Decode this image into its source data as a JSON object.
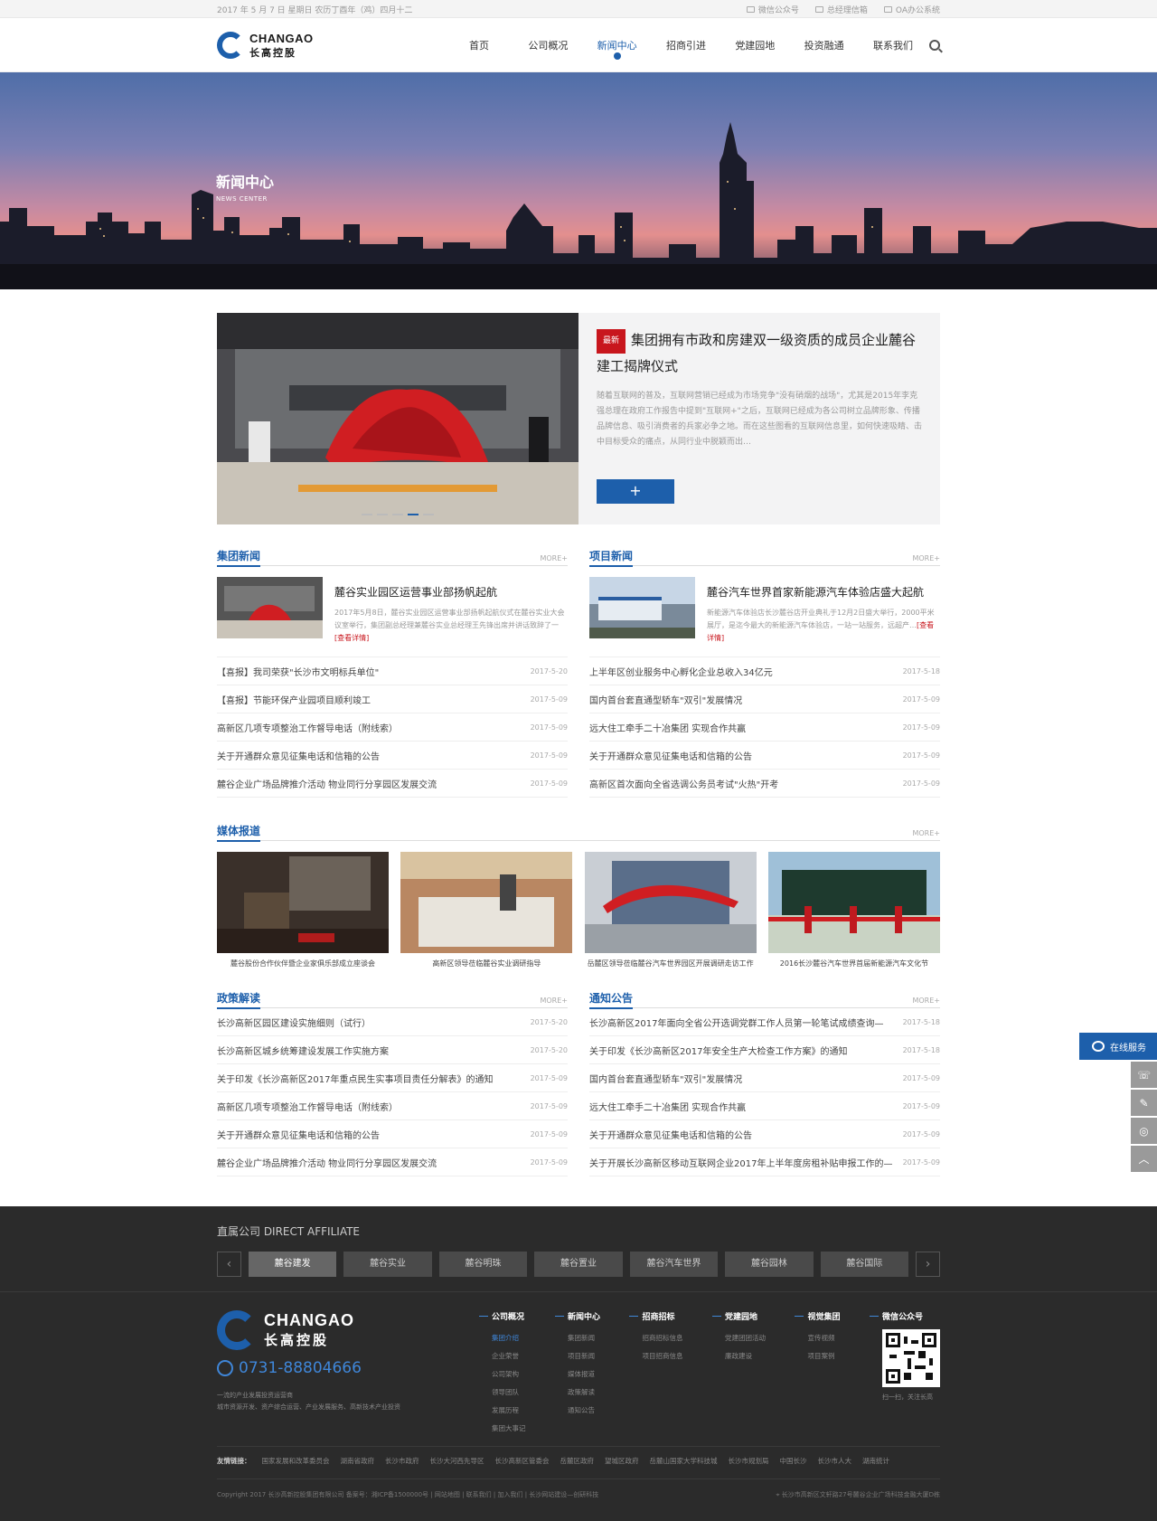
{
  "topbar": {
    "date": "2017 年 5 月 7 日  星期日  农历丁酉年（鸡）四月十二",
    "links": [
      "微信公众号",
      "总经理信箱",
      "OA办公系统"
    ]
  },
  "header": {
    "logo_en": "CHANGAO",
    "logo_cn": "长高控股",
    "nav": [
      "首页",
      "公司概况",
      "新闻中心",
      "招商引进",
      "党建园地",
      "投资融通",
      "联系我们"
    ],
    "active_nav": "新闻中心"
  },
  "banner": {
    "title_cn": "新闻中心",
    "title_en": "NEWS CENTER"
  },
  "feature": {
    "badge": "最新",
    "title": "集团拥有市政和房建双一级资质的成员企业麓谷建工揭牌仪式",
    "desc": "随着互联网的普及，互联网营销已经成为市场竞争\"没有硝烟的战场\"，尤其是2015年李克强总理在政府工作报告中提到\"互联网+\"之后，互联网已经成为各公司树立品牌形象、传播品牌信息、吸引消费者的兵家必争之地。而在这些图看的互联网信息里，如何快速吸睛、击中目标受众的痛点，从同行业中脱颖而出…",
    "button": "+"
  },
  "group_news": {
    "title": "集团新闻",
    "more": "MORE+",
    "top": {
      "headline": "麓谷实业园区运营事业部扬帆起航",
      "desc": "2017年5月8日，麓谷实业园区运营事业部扬帆起航仪式在麓谷实业大会议室举行，集团副总经理兼麓谷实业总经理王先锋出席并讲话致辞了一",
      "more": "[查看详情]"
    },
    "items": [
      {
        "title": "【喜报】我司荣获\"长沙市文明标兵单位\"",
        "date": "2017-5-20"
      },
      {
        "title": "【喜报】节能环保产业园项目顺利竣工",
        "date": "2017-5-09"
      },
      {
        "title": "高新区几项专项整治工作督导电话（附线索）",
        "date": "2017-5-09"
      },
      {
        "title": "关于开通群众意见征集电话和信箱的公告",
        "date": "2017-5-09"
      },
      {
        "title": "麓谷企业广场品牌推介活动  物业同行分享园区发展交流",
        "date": "2017-5-09"
      }
    ]
  },
  "project_news": {
    "title": "项目新闻",
    "more": "MORE+",
    "top": {
      "headline": "麓谷汽车世界首家新能源汽车体验店盛大起航",
      "desc": "新能源汽车体验店长沙麓谷店开业典礼于12月2日盛大举行，2000平米展厅，是迄今最大的新能源汽车体验店，一站一站服务，远超产…",
      "more": "[查看详情]"
    },
    "items": [
      {
        "title": "上半年区创业服务中心孵化企业总收入34亿元",
        "date": "2017-5-18"
      },
      {
        "title": "国内首台套直通型轿车\"双引\"发展情况",
        "date": "2017-5-09"
      },
      {
        "title": "远大住工牵手二十冶集团  实现合作共赢",
        "date": "2017-5-09"
      },
      {
        "title": "关于开通群众意见征集电话和信箱的公告",
        "date": "2017-5-09"
      },
      {
        "title": "高新区首次面向全省选调公务员考试\"火热\"开考",
        "date": "2017-5-09"
      }
    ]
  },
  "media": {
    "title": "媒体报道",
    "more": "MORE+",
    "items": [
      "麓谷股份合作伙伴暨企业家俱乐部成立座谈会",
      "高新区领导莅临麓谷实业调研指导",
      "岳麓区领导莅临麓谷汽车世界园区开展调研走访工作",
      "2016长沙麓谷汽车世界首届新能源汽车文化节"
    ]
  },
  "policy": {
    "title": "政策解读",
    "more": "MORE+",
    "items": [
      {
        "title": "长沙高新区园区建设实施细则（试行）",
        "date": "2017-5-20"
      },
      {
        "title": "长沙高新区城乡统筹建设发展工作实施方案",
        "date": "2017-5-20"
      },
      {
        "title": "关于印发《长沙高新区2017年重点民生实事项目责任分解表》的通知",
        "date": "2017-5-09"
      },
      {
        "title": "高新区几项专项整治工作督导电话（附线索）",
        "date": "2017-5-09"
      },
      {
        "title": "关于开通群众意见征集电话和信箱的公告",
        "date": "2017-5-09"
      },
      {
        "title": "麓谷企业广场品牌推介活动  物业同行分享园区发展交流",
        "date": "2017-5-09"
      }
    ]
  },
  "notice": {
    "title": "通知公告",
    "more": "MORE+",
    "items": [
      {
        "title": "长沙高新区2017年面向全省公开选调党群工作人员第一轮笔试成绩查询—",
        "date": "2017-5-18"
      },
      {
        "title": "关于印发《长沙高新区2017年安全生产大检查工作方案》的通知",
        "date": "2017-5-18"
      },
      {
        "title": "国内首台套直通型轿车\"双引\"发展情况",
        "date": "2017-5-09"
      },
      {
        "title": "远大住工牵手二十冶集团  实现合作共赢",
        "date": "2017-5-09"
      },
      {
        "title": "关于开通群众意见征集电话和信箱的公告",
        "date": "2017-5-09"
      },
      {
        "title": "关于开展长沙高新区移动互联网企业2017年上半年度房租补贴申报工作的—",
        "date": "2017-5-09"
      }
    ]
  },
  "affiliate": {
    "title": "直属公司 DIRECT AFFILIATE",
    "prev": "‹",
    "next": "›",
    "items": [
      "麓谷建发",
      "麓谷实业",
      "麓谷明珠",
      "麓谷置业",
      "麓谷汽车世界",
      "麓谷园林",
      "麓谷国际"
    ]
  },
  "footer": {
    "logo_en": "CHANGAO",
    "logo_cn": "长高控股",
    "phone": "0731-88804666",
    "slogan1": "一流的产业发展投资运营商",
    "slogan2": "城市资源开发、资产综合运营、产业发展服务、高新技术产业投资",
    "cols": [
      {
        "head": "公司概况",
        "links": [
          "集团介绍",
          "企业荣誉",
          "公司架构",
          "领导团队",
          "发展历程",
          "集团大事记"
        ]
      },
      {
        "head": "新闻中心",
        "links": [
          "集团新闻",
          "项目新闻",
          "媒体报道",
          "政策解读",
          "通知公告"
        ]
      },
      {
        "head": "招商招标",
        "links": [
          "招商招标信息",
          "项目招商信息"
        ]
      },
      {
        "head": "党建园地",
        "links": [
          "党建团团活动",
          "廉政建设"
        ]
      },
      {
        "head": "视觉集团",
        "links": [
          "宣传视频",
          "项目案例"
        ]
      }
    ],
    "wechat_head": "微信公众号",
    "wechat_cap": "扫一扫，关注长高",
    "friend_label": "友情链接：",
    "friends": [
      "国家发展和改革委员会",
      "湖南省政府",
      "长沙市政府",
      "长沙大河西先导区",
      "长沙高新区管委会",
      "岳麓区政府",
      "望城区政府",
      "岳麓山国家大学科技城",
      "长沙市规划局",
      "中国长沙",
      "长沙市人大",
      "湖南统计"
    ],
    "copyright": "Copyright 2017 长沙高新控股集团有限公司  备案号：湘ICP备1500000号  |  网站地图  |  联系我们  |  加入我们  |  长沙网站建设—创研科技",
    "address": "长沙市高新区文轩路27号麓谷企业广场科技金融大厦D栋"
  },
  "side": {
    "service": "在线服务"
  },
  "colors": {
    "brand": "#1d5fab",
    "badge": "#c8161d",
    "footer_bg": "#2b2b2b"
  }
}
